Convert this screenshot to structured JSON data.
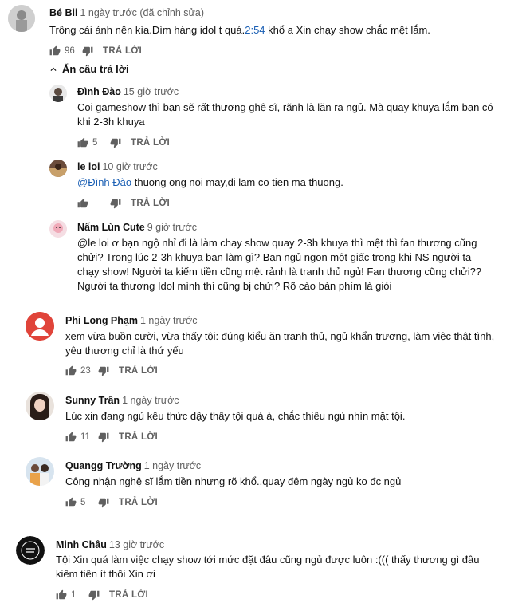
{
  "comments": [
    {
      "author": "Bé Bii",
      "time": "1 ngày trước (đã chỉnh sửa)",
      "text_before": "Trông cái ảnh nền kìa.Dìm hàng idol t quá.",
      "timestamp_link": "2:54",
      "text_after": " khổ a Xin chạy show chắc mệt lắm.",
      "likes": "96",
      "reply_label": "TRẢ LỜI"
    },
    {
      "author": "Đình Đào",
      "time": "15 giờ trước",
      "text": "Coi gameshow thì bạn sẽ rất thương ghệ sĩ, rãnh là lăn ra ngủ. Mà quay khuya lắm bạn có khi 2-3h khuya",
      "likes": "5",
      "reply_label": "TRẢ LỜI"
    },
    {
      "author": "le loi",
      "time": "10 giờ trước",
      "mention": "@Đình Đào",
      "text": " thuong ong noi may,di lam co tien ma thuong.",
      "likes": "",
      "reply_label": "TRẢ LỜI"
    },
    {
      "author": "Nấm Lùn Cute",
      "time": "9 giờ trước",
      "text": "@le loi ơ bạn ngộ nhỉ đi là làm chạy show quay 2-3h khuya thì mệt thì fan thương cũng chửi? Trong lúc 2-3h khuya bạn làm gì? Bạn ngủ ngon một giấc trong khi NS người ta chạy show! Người ta kiếm tiền cũng mệt rảnh là tranh thủ ngủ! Fan thương cũng chửi??Người ta thương Idol mình thì cũng bị chửi? Rõ cào bàn phím là giỏi"
    },
    {
      "author": "Phi Long Phạm",
      "time": "1 ngày trước",
      "text": "xem vừa buồn cười, vừa thấy tội: đúng kiểu ăn tranh thủ, ngủ khẩn trương, làm việc thật tình, yêu thương chỉ là thứ yếu",
      "likes": "23",
      "reply_label": "TRẢ LỜI"
    },
    {
      "author": "Sunny Trần",
      "time": "1 ngày trước",
      "text": "Lúc xin đang ngủ kêu thức dậy thấy tội quá à, chắc thiếu ngủ nhìn mặt tội.",
      "likes": "11",
      "reply_label": "TRẢ LỜI"
    },
    {
      "author": "Quangg Trường",
      "time": "1 ngày trước",
      "text": "Công nhận nghệ sĩ lắm tiền nhưng rõ khổ..quay đêm ngày ngủ ko đc ngủ",
      "likes": "5",
      "reply_label": "TRẢ LỜI"
    },
    {
      "author": "Minh Châu",
      "time": "13 giờ trước",
      "text": "Tội Xin quá làm việc chạy show tới mức đặt đâu cũng ngủ được luôn :((( thấy thương gì đâu kiếm tiền ít thôi Xin ơi",
      "likes": "1",
      "reply_label": "TRẢ LỜI"
    }
  ],
  "hide_replies_label": "Ẩn câu trả lời",
  "colors": {
    "link": "#1a5fb4",
    "phi_long_avatar": "#e0443a",
    "icon": "#606060"
  },
  "icons": {
    "like": "thumb-up-icon",
    "dislike": "thumb-down-icon",
    "collapse": "chevron-up-icon"
  }
}
